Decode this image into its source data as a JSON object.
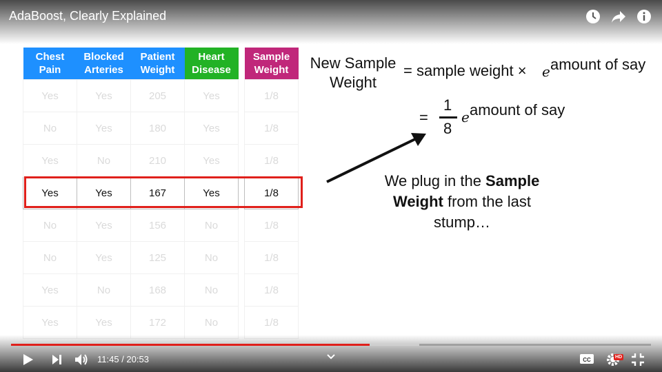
{
  "video": {
    "title": "AdaBoost, Clearly Explained"
  },
  "table": {
    "headers": [
      {
        "line1": "Chest",
        "line2": "Pain"
      },
      {
        "line1": "Blocked",
        "line2": "Arteries"
      },
      {
        "line1": "Patient",
        "line2": "Weight"
      },
      {
        "line1": "Heart",
        "line2": "Disease"
      },
      {
        "line1": "Sample",
        "line2": "Weight"
      }
    ],
    "rows": [
      [
        "Yes",
        "Yes",
        "205",
        "Yes",
        "1/8"
      ],
      [
        "No",
        "Yes",
        "180",
        "Yes",
        "1/8"
      ],
      [
        "Yes",
        "No",
        "210",
        "Yes",
        "1/8"
      ],
      [
        "Yes",
        "Yes",
        "167",
        "Yes",
        "1/8"
      ],
      [
        "No",
        "Yes",
        "156",
        "No",
        "1/8"
      ],
      [
        "No",
        "Yes",
        "125",
        "No",
        "1/8"
      ],
      [
        "Yes",
        "No",
        "168",
        "No",
        "1/8"
      ],
      [
        "Yes",
        "Yes",
        "172",
        "No",
        "1/8"
      ]
    ],
    "highlighted_row": 3
  },
  "equation": {
    "lhs_line1": "New Sample",
    "lhs_line2": "Weight",
    "rhs1": "= sample weight ×",
    "e": "e",
    "exponent": "amount of say",
    "eq2": "=",
    "numerator": "1",
    "denominator": "8",
    "e2": "e",
    "exponent2": "amount of say"
  },
  "annotation": {
    "line1_pre": "We plug in the ",
    "line1_bold": "Sample",
    "line2_bold": "Weight",
    "line2_post": " from the last",
    "line3": "stump…"
  },
  "player": {
    "current_time": "11:45",
    "separator": " / ",
    "duration": "20:53",
    "played_fraction": 0.56,
    "buffered_fraction": 0.638,
    "hd_badge": "HD",
    "icons": [
      "clock-icon",
      "share-icon",
      "info-icon",
      "play-icon",
      "next-icon",
      "volume-icon",
      "chevron-down-icon",
      "captions-icon",
      "settings-icon",
      "fullscreen-exit-icon"
    ]
  },
  "colors": {
    "blue_header": "#1E90FF",
    "green_header": "#22B225",
    "magenta_header": "#C0277A",
    "highlight_box": "#E0201B",
    "progress": "#E0201B"
  }
}
